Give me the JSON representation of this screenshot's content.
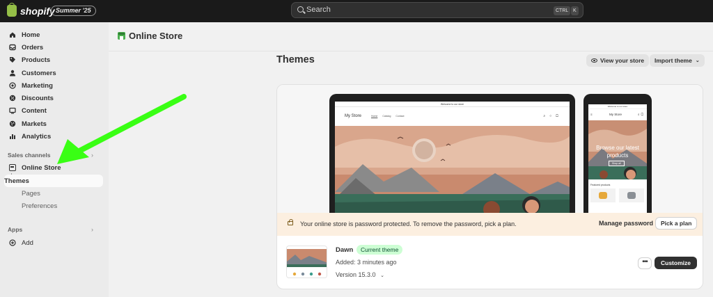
{
  "topbar": {
    "logo_text": "shopify",
    "edition_badge": "Summer '25",
    "search_placeholder": "Search",
    "shortcut_keys": [
      "CTRL",
      "K"
    ]
  },
  "sidebar": {
    "items": [
      {
        "label": "Home",
        "icon": "home-icon"
      },
      {
        "label": "Orders",
        "icon": "inbox-icon"
      },
      {
        "label": "Products",
        "icon": "tag-icon"
      },
      {
        "label": "Customers",
        "icon": "person-icon"
      },
      {
        "label": "Marketing",
        "icon": "target-icon"
      },
      {
        "label": "Discounts",
        "icon": "discount-icon"
      },
      {
        "label": "Content",
        "icon": "content-icon"
      },
      {
        "label": "Markets",
        "icon": "globe-icon"
      },
      {
        "label": "Analytics",
        "icon": "bar-chart-icon"
      }
    ],
    "sales_channels_label": "Sales channels",
    "online_store_label": "Online Store",
    "sub_items": [
      {
        "label": "Themes",
        "active": true
      },
      {
        "label": "Pages",
        "active": false
      },
      {
        "label": "Preferences",
        "active": false
      }
    ],
    "apps_label": "Apps",
    "add_label": "Add"
  },
  "header": {
    "title": "Online Store"
  },
  "main": {
    "title": "Themes",
    "view_store_label": "View your store",
    "import_theme_label": "Import theme"
  },
  "preview": {
    "desktop_announcement": "Welcome to our store",
    "desktop_store_name": "My Store",
    "desktop_nav_links": [
      "Home",
      "Catalog",
      "Contact"
    ],
    "mobile_announcement": "Welcome to our store",
    "mobile_store_name": "My Store",
    "mobile_hero_text": "Browse our latest products",
    "mobile_shop_all": "Shop all",
    "mobile_featured_label": "Featured products"
  },
  "password_notice": {
    "text": "Your online store is password protected. To remove the password, pick a plan.",
    "manage_label": "Manage password",
    "pick_plan_label": "Pick a plan"
  },
  "theme": {
    "name": "Dawn",
    "status_badge": "Current theme",
    "added": "Added: 3 minutes ago",
    "version": "Version 15.3.0",
    "more_label": "•••",
    "customize_label": "Customize"
  },
  "colors": {
    "topbar_bg": "#1a1a1a",
    "accent_arrow": "#39ff14",
    "badge_bg": "#cdfed4",
    "notice_bg": "#fcefe0",
    "primary_button": "#303030"
  }
}
